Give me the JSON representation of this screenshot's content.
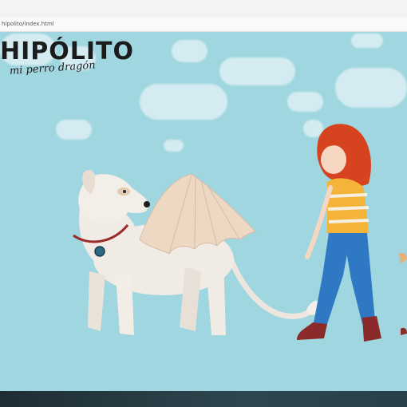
{
  "browser": {
    "url": "hipolito/index.html"
  },
  "page": {
    "title": "HIPÓLITO",
    "subtitle": "mi perro dragón"
  },
  "colors": {
    "sky": "#9fd6df",
    "hair": "#d8431f",
    "shirt_stripe": "#f4b43a",
    "pants": "#2f78c4",
    "boots": "#8a2a2a",
    "dog": "#f1ebe5",
    "wing": "#edd8c4",
    "collar": "#9c2a2a",
    "footer": "#1e2d33"
  }
}
